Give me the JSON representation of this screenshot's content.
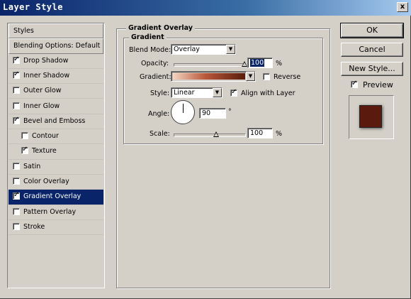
{
  "window": {
    "title": "Layer Style",
    "close_glyph": "x"
  },
  "sidebar": {
    "items": [
      {
        "label": "Styles",
        "checkbox": false,
        "checked": false
      },
      {
        "label": "Blending Options: Default",
        "checkbox": false,
        "checked": false
      },
      {
        "label": "Drop Shadow",
        "checkbox": true,
        "checked": true
      },
      {
        "label": "Inner Shadow",
        "checkbox": true,
        "checked": true
      },
      {
        "label": "Outer Glow",
        "checkbox": true,
        "checked": false
      },
      {
        "label": "Inner Glow",
        "checkbox": true,
        "checked": false
      },
      {
        "label": "Bevel and Emboss",
        "checkbox": true,
        "checked": true
      },
      {
        "label": "Contour",
        "checkbox": true,
        "checked": false
      },
      {
        "label": "Texture",
        "checkbox": true,
        "checked": true
      },
      {
        "label": "Satin",
        "checkbox": true,
        "checked": false
      },
      {
        "label": "Color Overlay",
        "checkbox": true,
        "checked": false
      },
      {
        "label": "Gradient Overlay",
        "checkbox": true,
        "checked": true
      },
      {
        "label": "Pattern Overlay",
        "checkbox": true,
        "checked": false
      },
      {
        "label": "Stroke",
        "checkbox": true,
        "checked": false
      }
    ],
    "check_glyph": "✓",
    "selected_label": "Gradient Overlay"
  },
  "panel": {
    "title": "Gradient Overlay",
    "group_title": "Gradient",
    "blend_mode_label": "Blend Mode:",
    "blend_mode_value": "Overlay",
    "opacity_label": "Opacity:",
    "opacity_value": "100",
    "opacity_unit": "%",
    "opacity_fraction": 1.0,
    "gradient_label": "Gradient:",
    "reverse_label": "Reverse",
    "reverse_checked": false,
    "style_label": "Style:",
    "style_value": "Linear",
    "align_label": "Align with Layer",
    "align_checked": true,
    "angle_label": "Angle:",
    "angle_value": "90",
    "angle_unit": "°",
    "scale_label": "Scale:",
    "scale_value": "100",
    "scale_unit": "%",
    "scale_fraction": 0.5
  },
  "buttons": {
    "ok": "OK",
    "cancel": "Cancel",
    "new_style": "New Style...",
    "preview_label": "Preview",
    "preview_checked": true
  },
  "colors": {
    "gradient_start": "#f3d3c0",
    "gradient_mid": "#b9583a",
    "gradient_end": "#5a1c0c",
    "preview_swatch": "#5a1a0e",
    "selection": "#0a246a"
  },
  "icons": {
    "dropdown": "chevron-down-icon",
    "close": "close-icon",
    "check": "check-icon"
  }
}
